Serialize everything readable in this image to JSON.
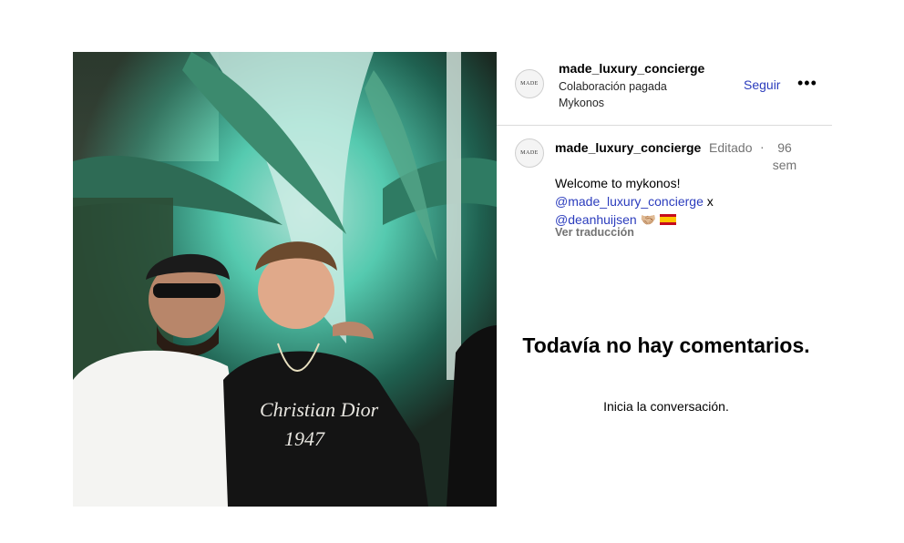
{
  "post": {
    "photo": {
      "icon": "post-photo-image"
    },
    "header": {
      "username": "made_luxury_concierge",
      "avatar_text": "MADE",
      "paid_partnership": "Colaboración pagada",
      "location": "Mykonos",
      "follow_label": "Seguir",
      "more_icon": "more-options-icon"
    },
    "caption": {
      "username": "made_luxury_concierge",
      "edited": "Editado",
      "separator": "·",
      "age": "96 sem",
      "text_line1": "Welcome to mykonos!",
      "mention1": "@made_luxury_concierge",
      "joiner": " x",
      "mention2": "@deanhuijsen",
      "emoji_handshake": "🤝🏼",
      "flag_icon": "spain-flag-icon",
      "translate_label": "Ver traducción"
    },
    "comments_empty": {
      "title": "Todavía no hay comentarios.",
      "subtitle": "Inicia la conversación."
    }
  }
}
